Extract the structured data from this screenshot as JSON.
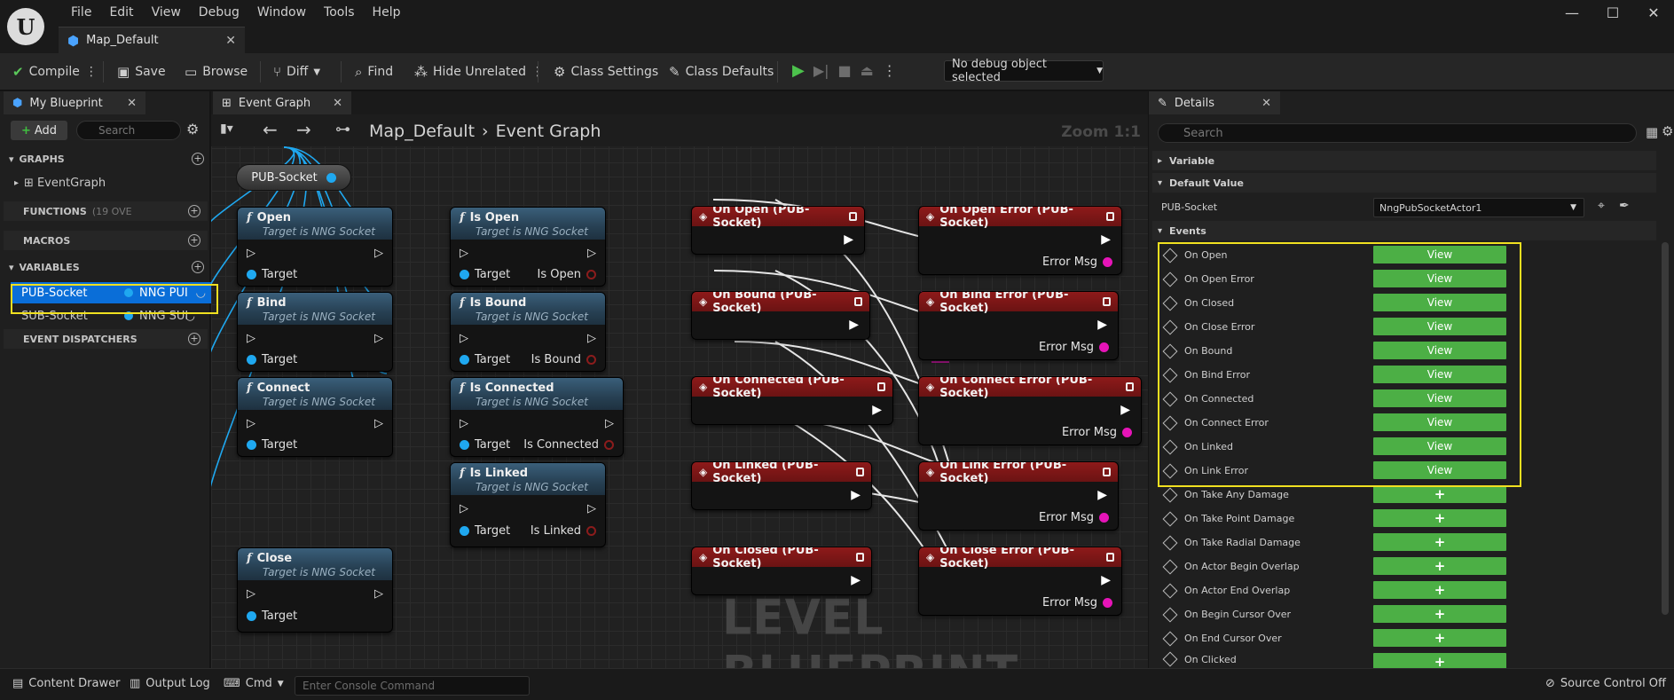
{
  "menu": [
    "File",
    "Edit",
    "View",
    "Debug",
    "Window",
    "Tools",
    "Help"
  ],
  "doc_tab": "Map_Default",
  "toolbar": {
    "compile": "Compile",
    "save": "Save",
    "browse": "Browse",
    "diff": "Diff",
    "find": "Find",
    "hide_unrelated": "Hide Unrelated",
    "class_settings": "Class Settings",
    "class_defaults": "Class Defaults",
    "debug_object": "No debug object selected"
  },
  "my_blueprint": {
    "tab": "My Blueprint",
    "add": "Add",
    "search_placeholder": "Search",
    "graphs": "GRAPHS",
    "event_graph_item": "EventGraph",
    "functions": "FUNCTIONS",
    "functions_count": "(19 OVE",
    "macros": "MACROS",
    "variables": "VARIABLES",
    "var1_name": "PUB-Socket",
    "var1_type": "NNG PUI",
    "var2_name": "SUB-Socket",
    "var2_type": "NNG SUI",
    "event_dispatchers": "EVENT DISPATCHERS"
  },
  "graph": {
    "tab": "Event Graph",
    "crumb_root": "Map_Default",
    "crumb_leaf": "Event Graph",
    "zoom": "Zoom 1:1",
    "watermark": "LEVEL BLUEPRINT",
    "var_node": "PUB-Socket",
    "target_label": "Target",
    "subtitle": "Target is NNG Socket",
    "error_msg": "Error Msg",
    "func_nodes": [
      "Open",
      "Bind",
      "Connect",
      "Close"
    ],
    "query_nodes": [
      {
        "title": "Is Open",
        "out": "Is Open"
      },
      {
        "title": "Is Bound",
        "out": "Is Bound"
      },
      {
        "title": "Is Connected",
        "out": "Is Connected"
      },
      {
        "title": "Is Linked",
        "out": "Is Linked"
      }
    ],
    "events": [
      "On Open (PUB-Socket)",
      "On Bound (PUB-Socket)",
      "On Connected (PUB-Socket)",
      "On Linked (PUB-Socket)",
      "On Closed (PUB-Socket)"
    ],
    "error_events": [
      "On Open Error (PUB-Socket)",
      "On Bind Error (PUB-Socket)",
      "On Connect Error (PUB-Socket)",
      "On Link Error (PUB-Socket)",
      "On Close Error (PUB-Socket)"
    ]
  },
  "details": {
    "tab": "Details",
    "search_placeholder": "Search",
    "variable_section": "Variable",
    "default_value_section": "Default Value",
    "pub_socket_label": "PUB-Socket",
    "pub_socket_value": "NngPubSocketActor1",
    "events_section": "Events",
    "view_label": "View",
    "add_label": "+",
    "bound_events": [
      "On Open",
      "On Open Error",
      "On Closed",
      "On Close Error",
      "On Bound",
      "On Bind Error",
      "On Connected",
      "On Connect Error",
      "On Linked",
      "On Link Error"
    ],
    "unbound_events": [
      "On Take Any Damage",
      "On Take Point Damage",
      "On Take Radial Damage",
      "On Actor Begin Overlap",
      "On Actor End Overlap",
      "On Begin Cursor Over",
      "On End Cursor Over",
      "On Clicked"
    ]
  },
  "status": {
    "content_drawer": "Content Drawer",
    "output_log": "Output Log",
    "cmd": "Cmd",
    "console_placeholder": "Enter Console Command",
    "source_control": "Source Control Off"
  },
  "colors": {
    "accent_blue": "#1fa8f0",
    "event_red": "#8e1a1a",
    "view_green": "#4caf45",
    "highlight_yellow": "#f0e020",
    "error_pin_magenta": "#e614b8"
  }
}
